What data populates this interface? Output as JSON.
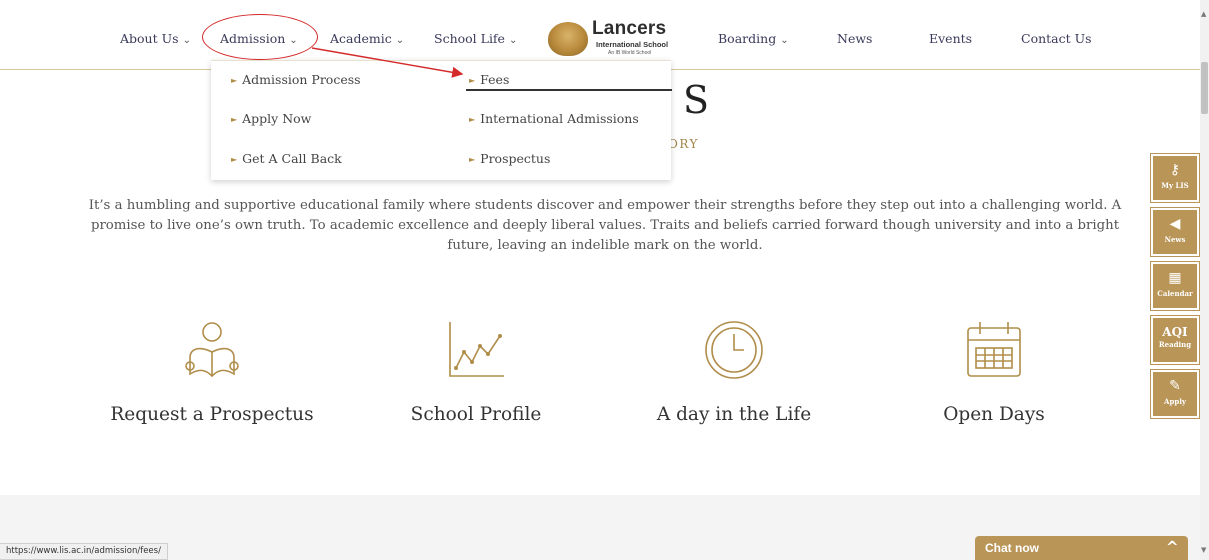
{
  "nav": {
    "items": [
      {
        "label": "About Us",
        "has_dropdown": true
      },
      {
        "label": "Admission",
        "has_dropdown": true
      },
      {
        "label": "Academic",
        "has_dropdown": true
      },
      {
        "label": "School Life",
        "has_dropdown": true
      },
      {
        "label": "Boarding",
        "has_dropdown": true
      },
      {
        "label": "News",
        "has_dropdown": false
      },
      {
        "label": "Events",
        "has_dropdown": false
      },
      {
        "label": "Contact Us",
        "has_dropdown": false
      }
    ],
    "chevron": "⌄"
  },
  "logo": {
    "name": "Lancers",
    "subtitle": "International School",
    "tagline": "An IB World School"
  },
  "dropdown": {
    "bullet": "►",
    "left_column": [
      "Admission Process",
      "Apply Now",
      "Get A Call Back"
    ],
    "right_column": [
      "Fees",
      "International Admissions",
      "Prospectus"
    ]
  },
  "hero": {
    "title_fragment": "S",
    "subtitle_fragment": "ORY",
    "paragraph": "It’s a humbling and supportive educational family where students discover and empower their strengths before they step out into a challenging world. A promise to live one’s own truth. To academic excellence and deeply liberal values. Traits and beliefs carried forward though university and into a bright future, leaving an indelible mark on the world."
  },
  "features": [
    {
      "label": "Request a Prospectus",
      "icon": "reading-person-icon"
    },
    {
      "label": "School Profile",
      "icon": "line-graph-icon"
    },
    {
      "label": "A day in the Life",
      "icon": "clock-icon"
    },
    {
      "label": "Open Days",
      "icon": "calendar-icon"
    }
  ],
  "side_widgets": [
    {
      "label": "My LIS",
      "icon": "key-icon"
    },
    {
      "label": "News",
      "icon": "megaphone-icon"
    },
    {
      "label": "Calendar",
      "icon": "calendar-icon"
    },
    {
      "label": "AQI",
      "sublabel": "Reading"
    },
    {
      "label": "Apply",
      "icon": "form-icon"
    }
  ],
  "status_bar": {
    "url": "https://www.lis.ac.in/admission/fees/"
  },
  "chat": {
    "label": "Chat now",
    "chevron": "^"
  },
  "colors": {
    "accent": "#b99558",
    "annotation": "#d42a2a",
    "nav_text": "#3a3a5a"
  }
}
